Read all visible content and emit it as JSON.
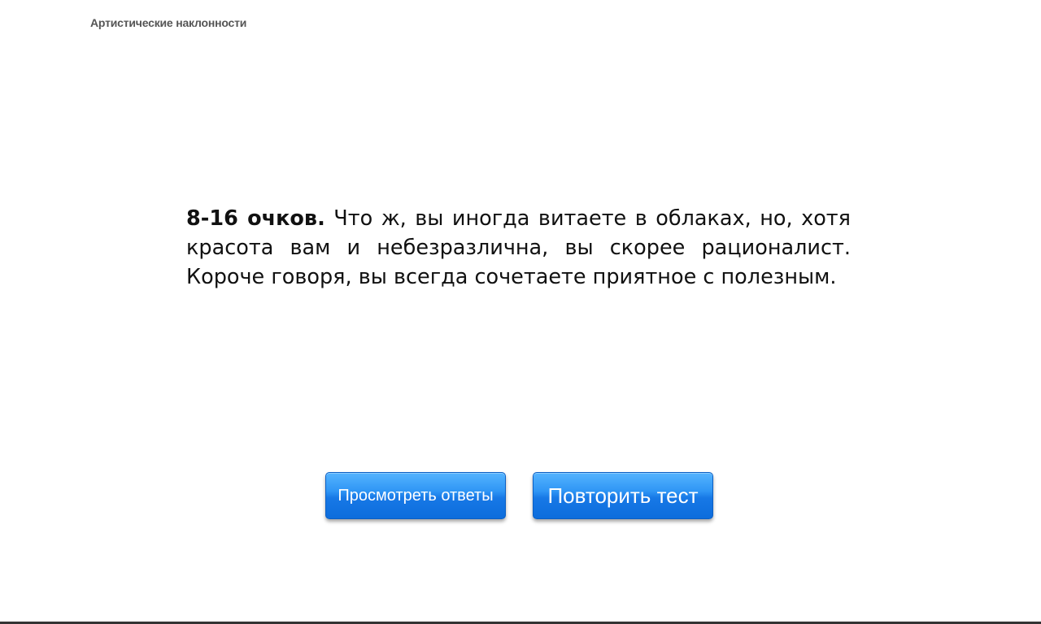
{
  "header": {
    "title": "Артистические наклонности"
  },
  "result": {
    "score_label": "8-16 очков.",
    "description": "Что ж, вы иногда витаете в облаках, но, хотя красота вам и небезразлична, вы скорее рационалист. Короче говоря, вы всегда сочетаете приятное с полезным."
  },
  "actions": {
    "view_answers_label": "Просмотреть ответы",
    "retry_label": "Повторить тест"
  },
  "colors": {
    "button_top": "#55b4ff",
    "button_bottom": "#0d6ddc",
    "text": "#111111"
  }
}
